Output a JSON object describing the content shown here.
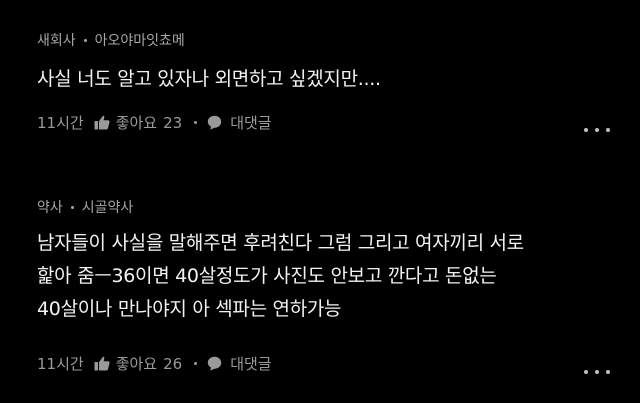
{
  "comments": [
    {
      "author": "새회사",
      "nickname": "아오야마잇쵸메",
      "lines": [
        "사실 너도 알고 있자나 외면하고 싶겠지만...."
      ],
      "time": "11시간",
      "like_label": "좋아요",
      "like_count": "23",
      "reply_label": "대댓글"
    },
    {
      "author": "약사",
      "nickname": "시골약사",
      "lines": [
        "남자들이 사실을 말해주면 후려친다 그럼 그리고 여자끼리 서로",
        "핥아 줌ㅡ36이면 40살정도가 사진도 안보고 깐다고 돈없는",
        "40살이나 만나야지 아 섹파는 연하가능"
      ],
      "time": "11시간",
      "like_label": "좋아요",
      "like_count": "26",
      "reply_label": "대댓글"
    }
  ],
  "icons": {
    "like": "thumbs-up-icon",
    "reply": "speech-bubble-icon",
    "more": "more-dots-icon"
  },
  "colors": {
    "background": "#000000",
    "meta_text": "#a6a6a6",
    "body_text": "#f2f2f2",
    "action_text": "#9a9a9a"
  }
}
